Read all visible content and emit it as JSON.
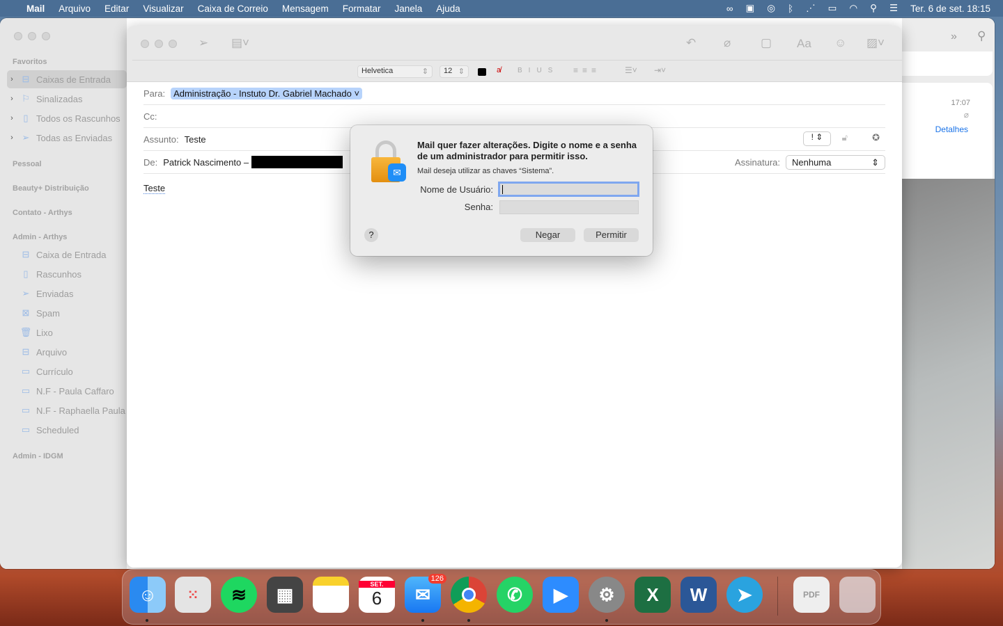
{
  "menubar": {
    "app": "Mail",
    "items": [
      "Arquivo",
      "Editar",
      "Visualizar",
      "Caixa de Correio",
      "Mensagem",
      "Formatar",
      "Janela",
      "Ajuda"
    ],
    "datetime": "Ter. 6 de set.  18:15"
  },
  "sidebar": {
    "sections": {
      "favoritos": "Favoritos",
      "pessoal": "Pessoal",
      "beauty": "Beauty+ Distribuição",
      "contato": "Contato - Arthys",
      "admin_arthys": "Admin - Arthys",
      "admin_idgm": "Admin - IDGM"
    },
    "favorites": [
      {
        "label": "Caixas de Entrada",
        "icon": "inbox-icon"
      },
      {
        "label": "Sinalizadas",
        "icon": "flag-icon"
      },
      {
        "label": "Todos os Rascunhos",
        "icon": "doc-icon"
      },
      {
        "label": "Todas as Enviadas",
        "icon": "send-icon"
      }
    ],
    "admin_items": [
      {
        "label": "Caixa de Entrada"
      },
      {
        "label": "Rascunhos"
      },
      {
        "label": "Enviadas"
      },
      {
        "label": "Spam"
      },
      {
        "label": "Lixo"
      },
      {
        "label": "Arquivo"
      },
      {
        "label": "Currículo"
      },
      {
        "label": "N.F - Paula Caffaro"
      },
      {
        "label": "N.F - Raphaella Paula"
      },
      {
        "label": "Scheduled"
      }
    ]
  },
  "viewer": {
    "time": "17:07",
    "details": "Detalhes"
  },
  "compose": {
    "font": "Helvetica",
    "size": "12",
    "to_label": "Para:",
    "to": "Administração - Instuto Dr. Gabriel Machado",
    "cc_label": "Cc:",
    "subject_label": "Assunto:",
    "subject": "Teste",
    "from_label": "De:",
    "from": "Patrick Nascimento –",
    "signature_label": "Assinatura:",
    "signature": "Nenhuma",
    "priority": "!",
    "body": "Teste",
    "font_button": "Aa"
  },
  "dialog": {
    "title": "Mail quer fazer alterações. Digite o nome e a senha de um administrador para permitir isso.",
    "subtitle": "Mail deseja utilizar as chaves “Sistema”.",
    "username_label": "Nome de Usuário:",
    "username": "",
    "password_label": "Senha:",
    "deny": "Negar",
    "allow": "Permitir",
    "help": "?"
  },
  "dock": {
    "calendar_month": "SET.",
    "calendar_day": "6",
    "mail_badge": "126"
  }
}
